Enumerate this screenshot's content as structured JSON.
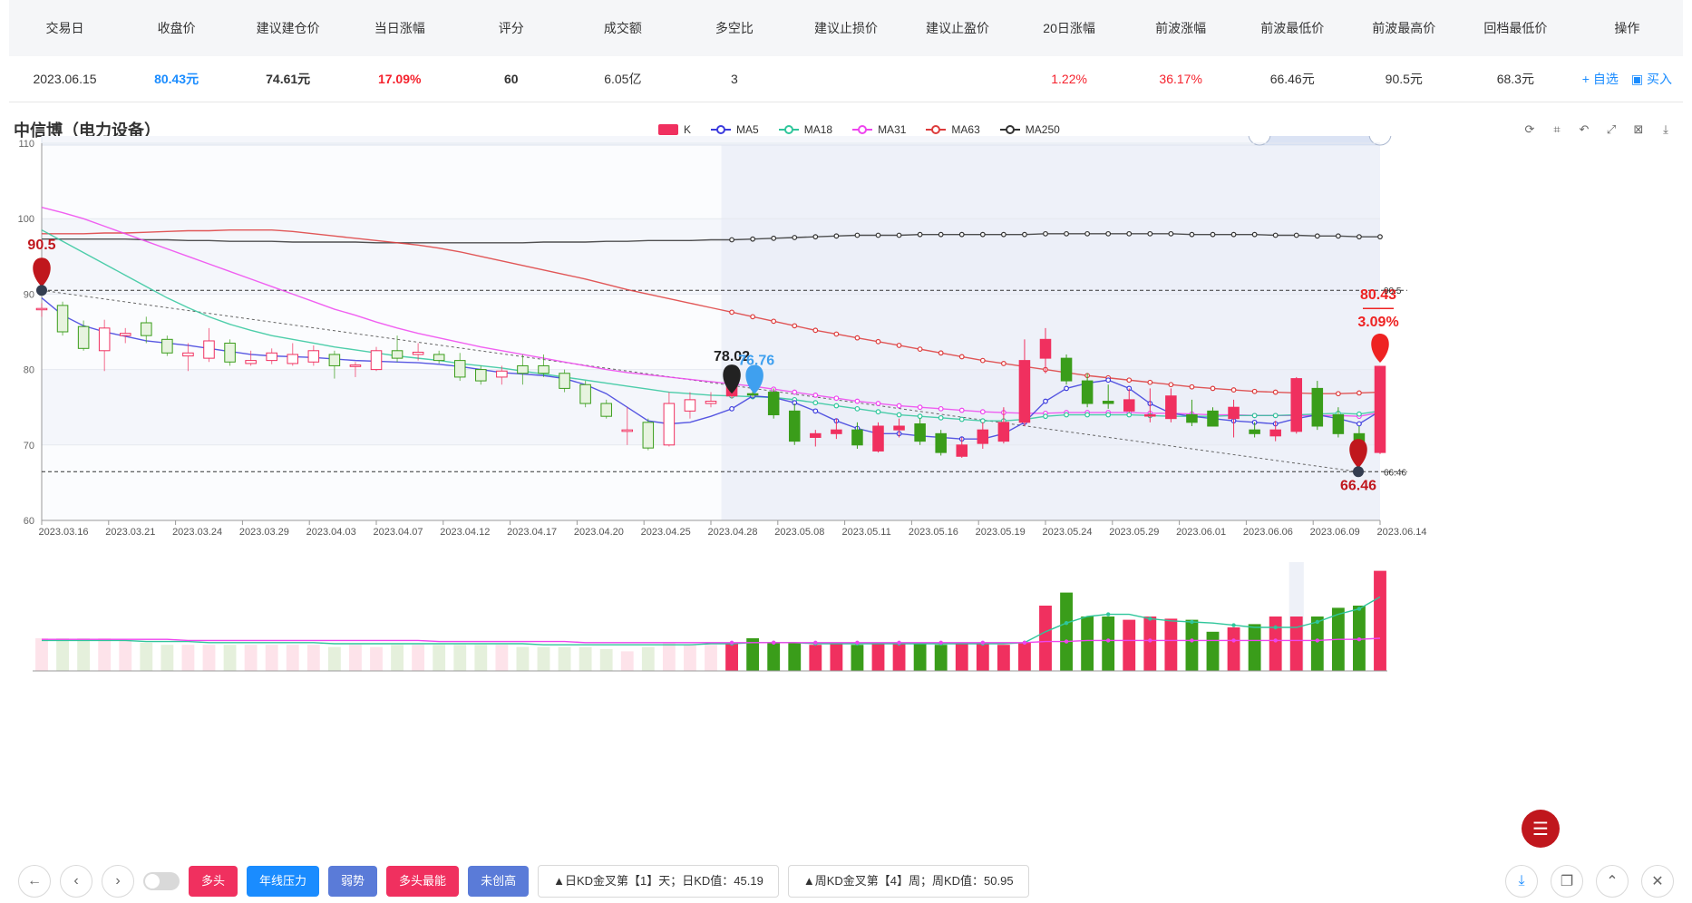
{
  "table": {
    "headers": [
      "交易日",
      "收盘价",
      "建议建仓价",
      "当日涨幅",
      "评分",
      "成交额",
      "多空比",
      "建议止损价",
      "建议止盈价",
      "20日涨幅",
      "前波涨幅",
      "前波最低价",
      "前波最高价",
      "回档最低价",
      "操作"
    ],
    "row": [
      "2023.06.15",
      "80.43元",
      "74.61元",
      "17.09%",
      "60",
      "6.05亿",
      "3",
      "",
      "",
      "1.22%",
      "36.17%",
      "66.46元",
      "90.5元",
      "68.3元"
    ],
    "op_watch": "+ 自选",
    "op_buy": "买入"
  },
  "stock_title": "中信博（电力设备）",
  "legend": {
    "k": "K",
    "ma5": "MA5",
    "ma18": "MA18",
    "ma31": "MA31",
    "ma63": "MA63",
    "ma250": "MA250"
  },
  "colors": {
    "up": "#f0305f",
    "down": "#3a9d1a",
    "ma5": "#3b3bdd",
    "ma18": "#2fc69b",
    "ma31": "#ee44ee",
    "ma63": "#dd3b3b",
    "ma250": "#333333",
    "accent": "#1a8cff"
  },
  "toolbox_icons": [
    "refresh-icon",
    "crop-icon",
    "undo-icon",
    "restore-icon",
    "zoom-reset-icon",
    "download-icon"
  ],
  "bottom": {
    "tags": [
      "多头",
      "年线压力",
      "弱势",
      "多头最能",
      "未创高"
    ],
    "tag_colors": [
      "#f0305f",
      "#1a8cff",
      "#5a7bd8",
      "#f0305f",
      "#5a7bd8"
    ],
    "info1": "▲日KD金叉第【1】天；日KD值：45.19",
    "info2": "▲周KD金叉第【4】周；周KD值：50.95"
  },
  "chart_data": {
    "type": "candlestick",
    "yaxis_ticks": [
      110,
      100,
      90,
      80,
      70,
      60
    ],
    "ylim": [
      60,
      110
    ],
    "x_tick_labels": [
      "2023.03.16",
      "2023.03.21",
      "2023.03.24",
      "2023.03.29",
      "2023.04.03",
      "2023.04.07",
      "2023.04.12",
      "2023.04.17",
      "2023.04.20",
      "2023.04.25",
      "2023.04.28",
      "2023.05.08",
      "2023.05.11",
      "2023.05.16",
      "2023.05.19",
      "2023.05.24",
      "2023.05.29",
      "2023.06.01",
      "2023.06.06",
      "2023.06.09",
      "2023.06.14"
    ],
    "annotations": {
      "high_value": "90.5",
      "low_value": "66.46",
      "last_price": "80.43",
      "last_change": "3.09%",
      "mark1": "78.02",
      "mark2": "76.76",
      "right_high": "90.5",
      "right_low": "66.46"
    },
    "candles": [
      [
        88.0,
        88.1,
        87.0,
        88.8
      ],
      [
        88.5,
        85.0,
        84.5,
        89.0
      ],
      [
        85.7,
        82.8,
        82.5,
        86.5
      ],
      [
        82.5,
        85.5,
        79.8,
        86.6
      ],
      [
        84.5,
        84.8,
        83.5,
        85.5
      ],
      [
        86.2,
        84.5,
        83.5,
        87.0
      ],
      [
        84.0,
        82.2,
        81.8,
        84.5
      ],
      [
        81.8,
        82.2,
        79.8,
        83.5
      ],
      [
        81.5,
        83.8,
        81.0,
        85.5
      ],
      [
        83.5,
        81.0,
        80.5,
        84.0
      ],
      [
        80.8,
        81.2,
        80.5,
        82.5
      ],
      [
        81.2,
        82.2,
        80.7,
        82.8
      ],
      [
        80.8,
        82.0,
        80.5,
        83.5
      ],
      [
        81.0,
        82.5,
        80.5,
        83.2
      ],
      [
        82.0,
        80.5,
        78.8,
        82.5
      ],
      [
        80.4,
        80.6,
        79.0,
        81.0
      ],
      [
        80.0,
        82.5,
        79.8,
        83.0
      ],
      [
        82.5,
        81.5,
        81.0,
        84.5
      ],
      [
        82.0,
        82.3,
        81.2,
        83.5
      ],
      [
        82.0,
        81.2,
        80.8,
        82.5
      ],
      [
        81.2,
        79.0,
        78.5,
        82.2
      ],
      [
        80.0,
        78.5,
        78.0,
        80.5
      ],
      [
        79.0,
        79.8,
        78.0,
        80.5
      ],
      [
        80.5,
        79.5,
        78.0,
        82.0
      ],
      [
        80.5,
        79.5,
        79.0,
        82.0
      ],
      [
        79.5,
        77.5,
        77.0,
        80.0
      ],
      [
        78.0,
        75.5,
        75.0,
        78.5
      ],
      [
        75.5,
        73.8,
        73.5,
        76.0
      ],
      [
        71.8,
        72.0,
        70.0,
        75.0
      ],
      [
        73.0,
        69.6,
        69.3,
        73.5
      ],
      [
        70.0,
        75.5,
        69.8,
        77.0
      ],
      [
        74.5,
        76.0,
        73.5,
        77.0
      ],
      [
        75.5,
        75.8,
        75.0,
        77.0
      ],
      [
        76.5,
        78.02,
        76.2,
        79.5
      ],
      [
        76.8,
        76.76,
        76.3,
        77.5
      ],
      [
        77.0,
        74.0,
        73.5,
        77.5
      ],
      [
        74.5,
        70.5,
        70.0,
        75.5
      ],
      [
        71.0,
        71.5,
        69.8,
        72.0
      ],
      [
        71.5,
        72.0,
        70.8,
        73.5
      ],
      [
        72.0,
        70.0,
        69.5,
        73.0
      ],
      [
        69.2,
        72.5,
        69.0,
        73.0
      ],
      [
        72.0,
        72.5,
        71.0,
        73.5
      ],
      [
        72.8,
        70.5,
        70.0,
        73.5
      ],
      [
        71.5,
        69.0,
        68.6,
        72.0
      ],
      [
        68.5,
        70.0,
        68.3,
        71.0
      ],
      [
        70.2,
        72.0,
        69.5,
        73.0
      ],
      [
        70.5,
        73.0,
        70.2,
        75.0
      ],
      [
        73.0,
        81.2,
        72.5,
        84.0
      ],
      [
        81.5,
        84.0,
        79.5,
        85.5
      ],
      [
        81.5,
        78.5,
        78.0,
        82.0
      ],
      [
        78.5,
        75.5,
        75.0,
        79.5
      ],
      [
        75.8,
        75.5,
        74.8,
        78.0
      ],
      [
        74.5,
        76.0,
        74.3,
        77.5
      ],
      [
        74.0,
        74.0,
        73.0,
        77.5
      ],
      [
        73.5,
        76.5,
        73.0,
        77.5
      ],
      [
        74.0,
        73.0,
        72.5,
        76.0
      ],
      [
        74.5,
        72.5,
        72.5,
        75.0
      ],
      [
        73.5,
        75.0,
        71.0,
        76.0
      ],
      [
        72.0,
        71.5,
        71.0,
        73.0
      ],
      [
        71.2,
        72.0,
        70.5,
        73.2
      ],
      [
        71.8,
        78.8,
        71.5,
        79.0
      ],
      [
        77.5,
        72.5,
        72.0,
        78.5
      ],
      [
        74.0,
        71.5,
        71.0,
        75.0
      ],
      [
        71.5,
        69.5,
        69.0,
        72.5
      ],
      [
        69.0,
        80.43,
        68.8,
        80.5
      ]
    ],
    "ma5": [
      89.5,
      87.2,
      85.8,
      85.0,
      84.4,
      83.8,
      83.5,
      83.2,
      82.8,
      82.4,
      82.0,
      81.8,
      81.7,
      81.6,
      81.4,
      81.2,
      81.1,
      81.0,
      80.9,
      80.7,
      80.4,
      80.0,
      79.6,
      79.4,
      79.2,
      78.8,
      78.0,
      76.8,
      75.0,
      73.2,
      72.8,
      73.0,
      73.8,
      74.8,
      76.5,
      76.3,
      75.6,
      74.5,
      73.2,
      72.2,
      71.5,
      71.5,
      71.2,
      71.0,
      70.8,
      70.8,
      71.5,
      73.0,
      75.8,
      77.5,
      78.2,
      78.6,
      77.5,
      75.5,
      74.2,
      73.8,
      73.5,
      73.2,
      73.0,
      72.8,
      73.5,
      74.0,
      73.5,
      72.8,
      74.5
    ],
    "ma18": [
      98.5,
      97.0,
      95.5,
      94.0,
      92.5,
      91.0,
      89.5,
      88.2,
      87.0,
      86.0,
      85.2,
      84.5,
      84.0,
      83.5,
      83.0,
      82.6,
      82.2,
      81.8,
      81.5,
      81.2,
      80.8,
      80.5,
      80.2,
      79.8,
      79.4,
      79.0,
      78.6,
      78.2,
      77.8,
      77.4,
      77.0,
      76.8,
      76.6,
      76.5,
      76.4,
      76.3,
      76.0,
      75.6,
      75.2,
      74.8,
      74.4,
      74.0,
      73.8,
      73.6,
      73.4,
      73.2,
      73.2,
      73.4,
      73.8,
      74.0,
      74.0,
      74.0,
      74.0,
      73.9,
      73.8,
      73.8,
      73.8,
      73.9,
      73.9,
      73.9,
      74.0,
      74.1,
      74.2,
      74.1,
      74.5
    ],
    "ma31": [
      101.5,
      100.8,
      100.0,
      99.0,
      98.0,
      97.0,
      96.0,
      95.0,
      94.0,
      93.0,
      92.0,
      91.0,
      90.0,
      89.0,
      88.0,
      87.2,
      86.3,
      85.5,
      84.8,
      84.2,
      83.6,
      83.0,
      82.5,
      82.0,
      81.5,
      81.0,
      80.5,
      80.0,
      79.6,
      79.3,
      79.0,
      78.7,
      78.4,
      78.1,
      77.8,
      77.4,
      77.0,
      76.6,
      76.2,
      75.8,
      75.5,
      75.2,
      75.0,
      74.8,
      74.6,
      74.4,
      74.3,
      74.2,
      74.2,
      74.3,
      74.3,
      74.3,
      74.3,
      74.2,
      74.2,
      74.1,
      74.0,
      74.0,
      73.9,
      73.9,
      73.9,
      73.9,
      73.9,
      73.8,
      74.3
    ],
    "ma63": [
      98.0,
      98.0,
      98.0,
      98.1,
      98.1,
      98.2,
      98.3,
      98.4,
      98.4,
      98.5,
      98.5,
      98.5,
      98.3,
      98.0,
      97.7,
      97.4,
      97.1,
      96.8,
      96.5,
      96.1,
      95.6,
      95.0,
      94.4,
      93.8,
      93.2,
      92.6,
      92.0,
      91.3,
      90.6,
      90.0,
      89.4,
      88.8,
      88.2,
      87.6,
      87.0,
      86.4,
      85.8,
      85.2,
      84.7,
      84.2,
      83.7,
      83.2,
      82.7,
      82.2,
      81.7,
      81.2,
      80.8,
      80.4,
      80.0,
      79.6,
      79.2,
      78.9,
      78.6,
      78.3,
      78.0,
      77.7,
      77.5,
      77.3,
      77.1,
      77.0,
      76.9,
      76.8,
      76.8,
      76.9,
      77.0
    ],
    "ma250": [
      97.3,
      97.3,
      97.3,
      97.3,
      97.3,
      97.2,
      97.2,
      97.1,
      97.1,
      97.0,
      97.0,
      97.0,
      96.9,
      96.9,
      96.9,
      96.9,
      96.8,
      96.8,
      96.8,
      96.8,
      96.8,
      96.8,
      96.8,
      96.8,
      96.9,
      96.9,
      96.9,
      97.0,
      97.0,
      97.1,
      97.1,
      97.1,
      97.2,
      97.2,
      97.3,
      97.4,
      97.5,
      97.6,
      97.7,
      97.8,
      97.8,
      97.8,
      97.9,
      97.9,
      97.9,
      97.9,
      97.9,
      97.9,
      98.0,
      98.0,
      98.0,
      98.0,
      98.0,
      98.0,
      98.0,
      97.9,
      97.9,
      97.9,
      97.9,
      97.8,
      97.8,
      97.7,
      97.7,
      97.6,
      97.6
    ],
    "volume": [
      30,
      30,
      30,
      30,
      28,
      26,
      24,
      24,
      24,
      24,
      24,
      24,
      24,
      24,
      22,
      24,
      22,
      24,
      24,
      24,
      24,
      24,
      24,
      22,
      22,
      22,
      22,
      20,
      18,
      22,
      26,
      24,
      24,
      26,
      30,
      26,
      26,
      24,
      26,
      24,
      26,
      26,
      26,
      24,
      26,
      26,
      24,
      26,
      60,
      72,
      50,
      50,
      47,
      50,
      48,
      47,
      36,
      40,
      43,
      50,
      50,
      50,
      58,
      60,
      92
    ],
    "vol_ma_a": [
      28,
      28,
      28,
      28,
      28,
      27,
      27,
      27,
      26,
      26,
      26,
      26,
      26,
      26,
      25,
      25,
      25,
      25,
      25,
      25,
      25,
      25,
      25,
      25,
      24,
      24,
      24,
      24,
      24,
      24,
      24,
      24,
      25,
      25,
      26,
      26,
      26,
      25,
      25,
      25,
      25,
      25,
      25,
      25,
      25,
      25,
      25,
      26,
      36,
      44,
      50,
      52,
      52,
      48,
      46,
      45,
      44,
      42,
      40,
      40,
      40,
      45,
      52,
      57,
      68
    ],
    "vol_ma_b": [
      29,
      29,
      29,
      29,
      29,
      29,
      29,
      28,
      28,
      28,
      28,
      28,
      28,
      28,
      28,
      28,
      28,
      28,
      28,
      27,
      27,
      27,
      27,
      27,
      27,
      27,
      26,
      26,
      26,
      26,
      26,
      26,
      26,
      26,
      26,
      26,
      26,
      26,
      26,
      26,
      26,
      26,
      26,
      26,
      26,
      26,
      26,
      26,
      27,
      27,
      28,
      28,
      28,
      28,
      28,
      28,
      28,
      28,
      28,
      28,
      28,
      28,
      29,
      29,
      30
    ]
  }
}
